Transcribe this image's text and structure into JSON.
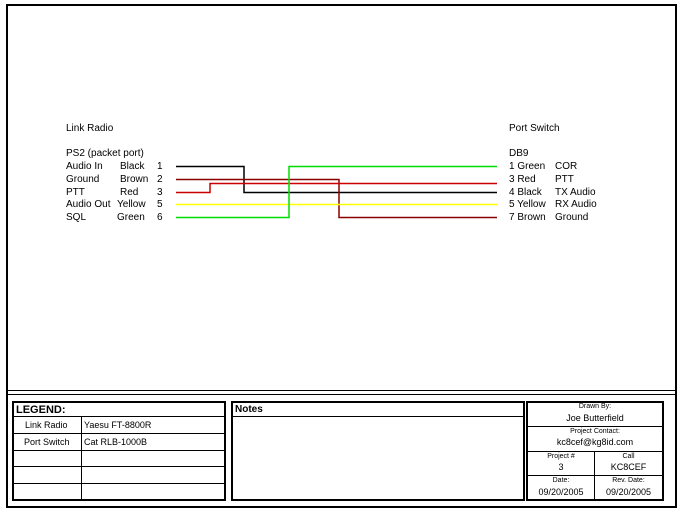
{
  "left_header": {
    "title": "Link Radio",
    "connector": "PS2 (packet port)"
  },
  "left_pins": [
    {
      "name": "Audio In",
      "color": "Black",
      "pin": "1"
    },
    {
      "name": "Ground",
      "color": "Brown",
      "pin": "2"
    },
    {
      "name": "PTT",
      "color": "Red",
      "pin": "3"
    },
    {
      "name": "Audio Out",
      "color": "Yellow",
      "pin": "5"
    },
    {
      "name": "SQL",
      "color": "Green",
      "pin": "6"
    }
  ],
  "right_header": {
    "title": "Port Switch",
    "connector": "DB9"
  },
  "right_pins": [
    {
      "label": "1 Green",
      "signal": "COR"
    },
    {
      "label": "3 Red",
      "signal": "PTT"
    },
    {
      "label": "4 Black",
      "signal": "TX Audio"
    },
    {
      "label": "5 Yellow",
      "signal": "RX Audio"
    },
    {
      "label": "7 Brown",
      "signal": "Ground"
    }
  ],
  "wire_colors": {
    "black": "#000000",
    "brown": "#8b0000",
    "red": "#cc0000",
    "yellow": "#ffff00",
    "green": "#00dd00"
  },
  "legend": {
    "title": "LEGEND:",
    "rows": [
      {
        "key": "Link Radio",
        "value": "Yaesu FT-8800R"
      },
      {
        "key": "Port Switch",
        "value": "Cat RLB-1000B"
      },
      {
        "key": "",
        "value": ""
      },
      {
        "key": "",
        "value": ""
      },
      {
        "key": "",
        "value": ""
      }
    ]
  },
  "notes": {
    "title": "Notes"
  },
  "title_block": {
    "drawn_by_label": "Drawn By:",
    "drawn_by": "Joe Butterfield",
    "contact_label": "Project Contact:",
    "contact": "kc8cef@kg8id.com",
    "project_label": "Project #",
    "project": "3",
    "call_label": "Call",
    "call": "KC8CEF",
    "date_label": "Date:",
    "date": "09/20/2005",
    "rev_label": "Rev. Date:",
    "rev_date": "09/20/2005"
  }
}
